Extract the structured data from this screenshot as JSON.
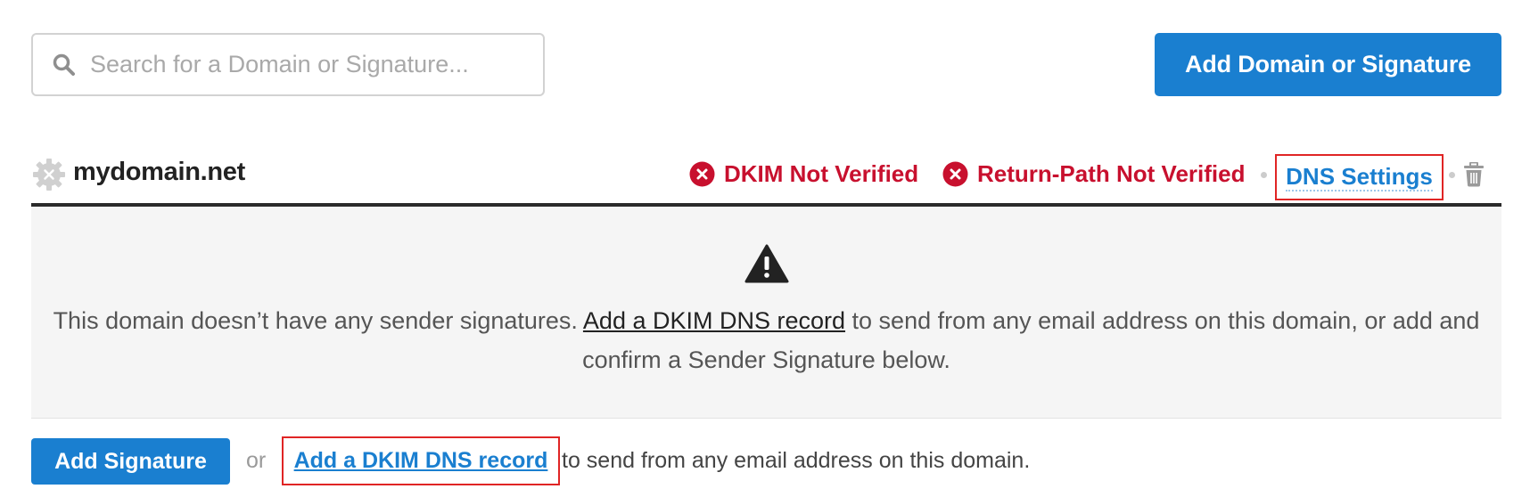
{
  "search": {
    "placeholder": "Search for a Domain or Signature...",
    "value": ""
  },
  "toolbar": {
    "add_domain_label": "Add Domain or Signature"
  },
  "domain": {
    "name": "mydomain.net",
    "icon": "gear-icon",
    "statuses": [
      {
        "label": "DKIM Not Verified",
        "icon": "error-x-icon",
        "color": "#c8102e"
      },
      {
        "label": "Return-Path Not Verified",
        "icon": "error-x-icon",
        "color": "#c8102e"
      }
    ],
    "dns_settings_label": "DNS Settings",
    "delete_icon": "trash-icon"
  },
  "notice": {
    "icon": "warning-icon",
    "text_before": "This domain doesn’t have any sender signatures. ",
    "link": "Add a DKIM DNS record",
    "text_after": " to send from any email address on this domain, or add and confirm a Sender Signature below."
  },
  "footer": {
    "add_signature_label": "Add Signature",
    "or_text": "or",
    "dkim_link": "Add a DKIM DNS record",
    "text_after": "to send from any email address on this domain."
  },
  "colors": {
    "primary": "#1a7fd0",
    "error": "#c8102e",
    "highlight_box": "#e02525",
    "panel_bg": "#f5f5f5"
  }
}
